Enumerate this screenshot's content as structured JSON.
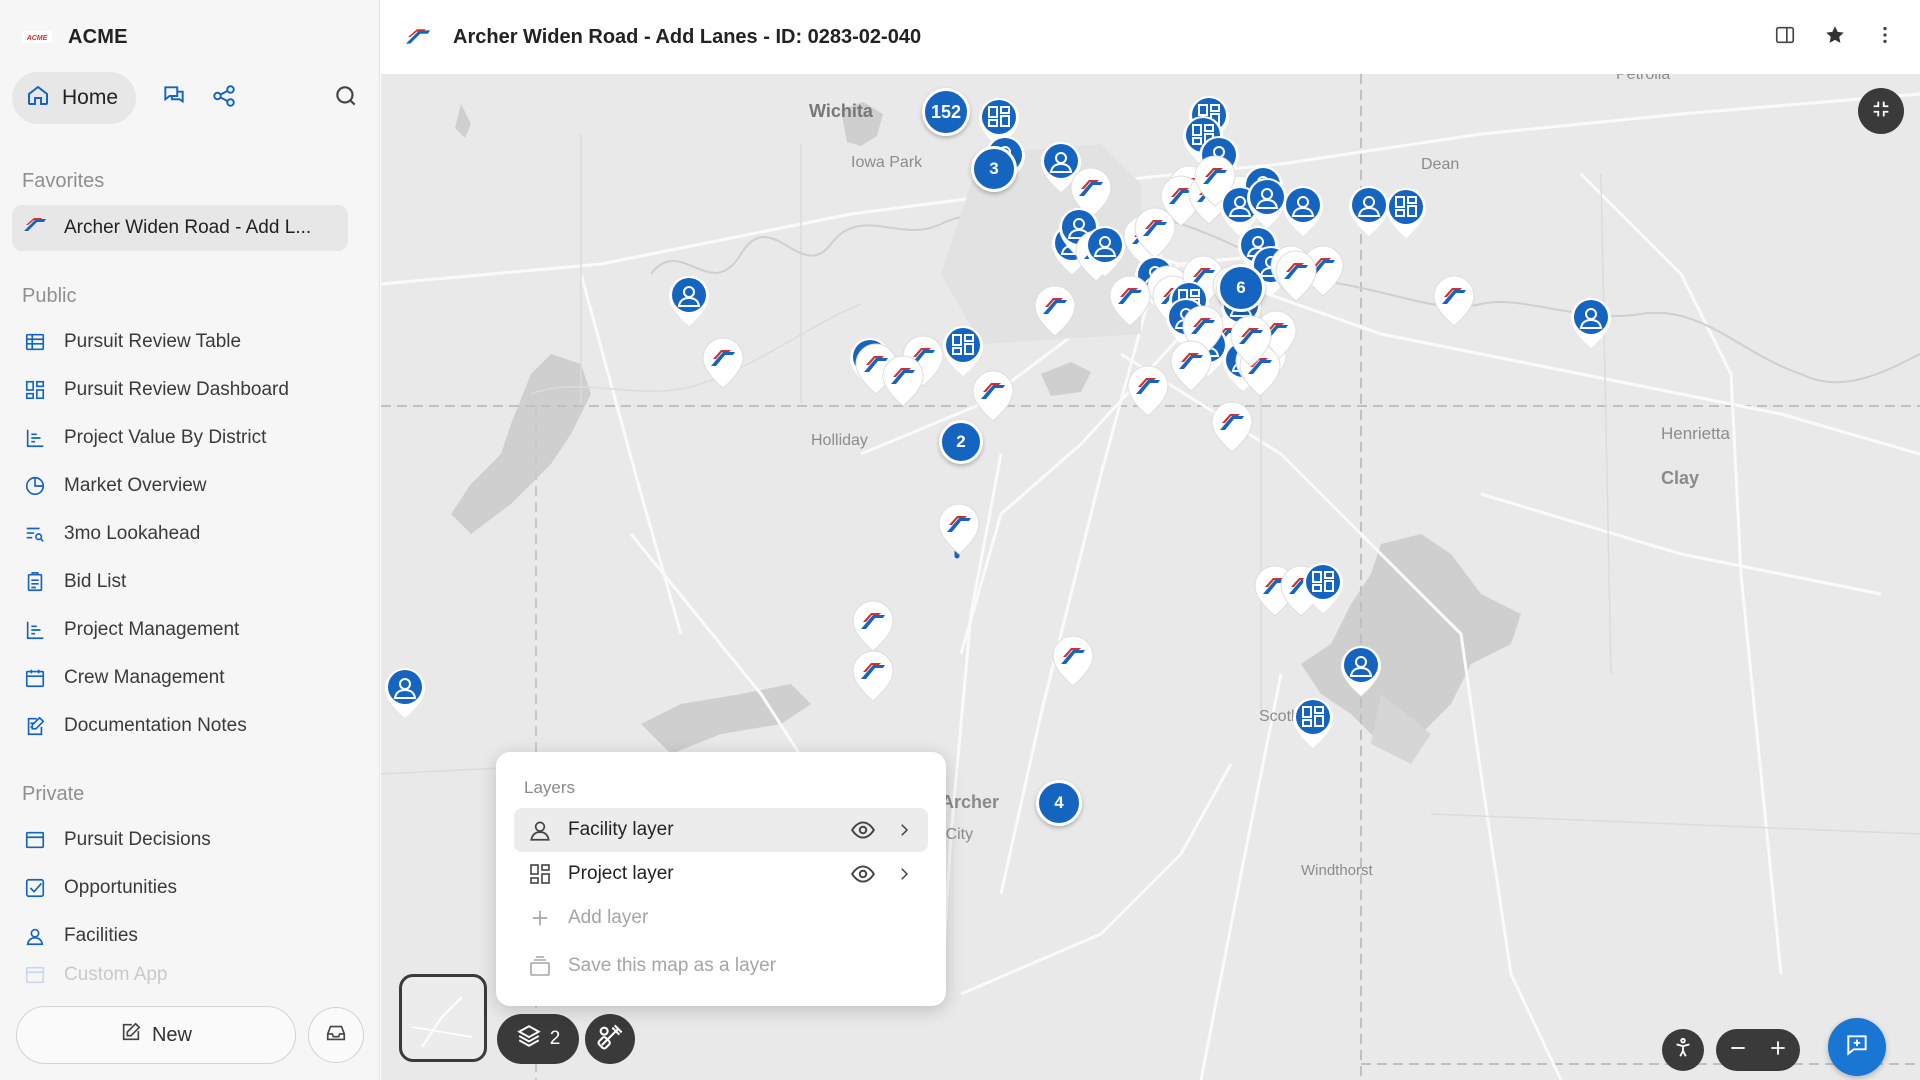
{
  "app": {
    "name": "ACME",
    "logo_text": "ACME"
  },
  "nav": {
    "home_label": "Home"
  },
  "sections": {
    "favorites": "Favorites",
    "public": "Public",
    "private": "Private"
  },
  "favorites": [
    {
      "label": "Archer Widen Road - Add L...",
      "icon": "project-logo"
    }
  ],
  "public_items": [
    {
      "label": "Pursuit Review Table",
      "icon": "table-icon"
    },
    {
      "label": "Pursuit Review Dashboard",
      "icon": "dashboard-icon"
    },
    {
      "label": "Project Value By District",
      "icon": "bar-chart-icon"
    },
    {
      "label": "Market Overview",
      "icon": "pie-chart-icon"
    },
    {
      "label": "3mo Lookahead",
      "icon": "list-search-icon"
    },
    {
      "label": "Bid List",
      "icon": "clipboard-icon"
    },
    {
      "label": "Project Management",
      "icon": "bar-chart-icon"
    },
    {
      "label": "Crew Management",
      "icon": "calendar-icon"
    },
    {
      "label": "Documentation Notes",
      "icon": "edit-note-icon"
    }
  ],
  "private_items": [
    {
      "label": "Pursuit Decisions",
      "icon": "window-icon"
    },
    {
      "label": "Opportunities",
      "icon": "checkbox-icon"
    },
    {
      "label": "Facilities",
      "icon": "facility-icon"
    },
    {
      "label": "Custom App",
      "icon": "window-icon"
    }
  ],
  "bottom": {
    "new_label": "New"
  },
  "header": {
    "title": "Archer Widen Road - Add Lanes - ID: 0283-02-040"
  },
  "map": {
    "places": [
      {
        "name": "Petrolia"
      },
      {
        "name": "Wichita"
      },
      {
        "name": "Iowa Park"
      },
      {
        "name": "Dean"
      },
      {
        "name": "Henrietta"
      },
      {
        "name": "Clay"
      },
      {
        "name": "Holliday"
      },
      {
        "name": "Scotland"
      },
      {
        "name": "Archer"
      },
      {
        "name": "Archer City"
      },
      {
        "name": "Windthorst"
      }
    ],
    "clusters": [
      {
        "count": "152"
      },
      {
        "count": "3"
      },
      {
        "count": "6"
      },
      {
        "count": "2"
      },
      {
        "count": "4"
      }
    ]
  },
  "layers_panel": {
    "title": "Layers",
    "layers": [
      {
        "label": "Facility layer",
        "visible": true,
        "icon": "facility-icon"
      },
      {
        "label": "Project layer",
        "visible": true,
        "icon": "dashboard-icon"
      }
    ],
    "add_label": "Add layer",
    "save_label": "Save this map as a layer"
  },
  "controls": {
    "layer_count": "2"
  },
  "colors": {
    "accent": "#1565c0",
    "dark": "#3a3a3a",
    "brand_red": "#d32f2f"
  }
}
